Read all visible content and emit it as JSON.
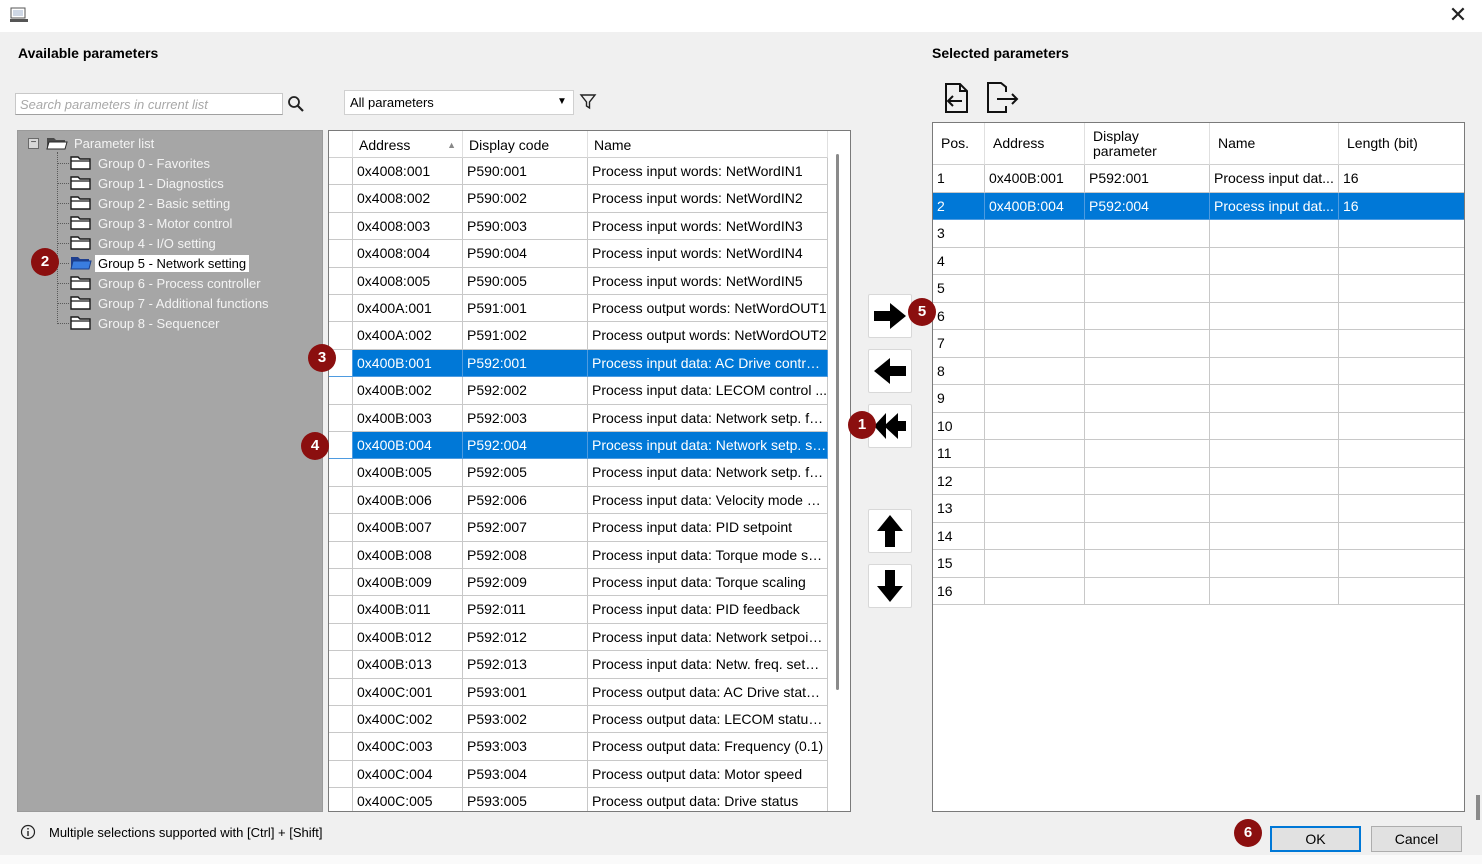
{
  "window": {
    "close_glyph": "✕"
  },
  "available": {
    "title": "Available parameters",
    "search_placeholder": "Search parameters in current list",
    "filter_value": "All parameters",
    "tree": {
      "root": "Parameter list",
      "groups": [
        "Group 0 - Favorites",
        "Group 1 - Diagnostics",
        "Group 2 - Basic setting",
        "Group 3 - Motor control",
        "Group 4 - I/O setting",
        "Group 5 - Network setting",
        "Group 6 - Process controller",
        "Group 7 - Additional functions",
        "Group 8 - Sequencer"
      ],
      "selected_index": 5
    },
    "columns": [
      "Address",
      "Display code",
      "Name"
    ],
    "rows": [
      [
        "0x4008:001",
        "P590:001",
        "Process input words: NetWordIN1"
      ],
      [
        "0x4008:002",
        "P590:002",
        "Process input words: NetWordIN2"
      ],
      [
        "0x4008:003",
        "P590:003",
        "Process input words: NetWordIN3"
      ],
      [
        "0x4008:004",
        "P590:004",
        "Process input words: NetWordIN4"
      ],
      [
        "0x4008:005",
        "P590:005",
        "Process input words: NetWordIN5"
      ],
      [
        "0x400A:001",
        "P591:001",
        "Process output words: NetWordOUT1"
      ],
      [
        "0x400A:002",
        "P591:002",
        "Process output words: NetWordOUT2"
      ],
      [
        "0x400B:001",
        "P592:001",
        "Process input data: AC Drive control ..."
      ],
      [
        "0x400B:002",
        "P592:002",
        "Process input data: LECOM control ..."
      ],
      [
        "0x400B:003",
        "P592:003",
        "Process input data: Network setp. fre..."
      ],
      [
        "0x400B:004",
        "P592:004",
        "Process input data: Network setp. sp..."
      ],
      [
        "0x400B:005",
        "P592:005",
        "Process input data: Network setp. fre..."
      ],
      [
        "0x400B:006",
        "P592:006",
        "Process input data: Velocity mode se..."
      ],
      [
        "0x400B:007",
        "P592:007",
        "Process input data: PID setpoint"
      ],
      [
        "0x400B:008",
        "P592:008",
        "Process input data: Torque mode set..."
      ],
      [
        "0x400B:009",
        "P592:009",
        "Process input data: Torque scaling"
      ],
      [
        "0x400B:011",
        "P592:011",
        "Process input data: PID feedback"
      ],
      [
        "0x400B:012",
        "P592:012",
        "Process input data: Network setpoint..."
      ],
      [
        "0x400B:013",
        "P592:013",
        "Process input data: Netw. freq. setp. ..."
      ],
      [
        "0x400C:001",
        "P593:001",
        "Process output data: AC Drive status..."
      ],
      [
        "0x400C:002",
        "P593:002",
        "Process output data: LECOM status ..."
      ],
      [
        "0x400C:003",
        "P593:003",
        "Process output data: Frequency (0.1)"
      ],
      [
        "0x400C:004",
        "P593:004",
        "Process output data: Motor speed"
      ],
      [
        "0x400C:005",
        "P593:005",
        "Process output data: Drive status"
      ]
    ],
    "selected_rows": [
      7,
      10
    ]
  },
  "selected": {
    "title": "Selected parameters",
    "columns": [
      "Pos.",
      "Address",
      "Display parameter",
      "Name",
      "Length (bit)"
    ],
    "rows": [
      [
        "1",
        "0x400B:001",
        "P592:001",
        "Process input dat...",
        "16"
      ],
      [
        "2",
        "0x400B:004",
        "P592:004",
        "Process input dat...",
        "16"
      ],
      [
        "3",
        "",
        "",
        "",
        ""
      ],
      [
        "4",
        "",
        "",
        "",
        ""
      ],
      [
        "5",
        "",
        "",
        "",
        ""
      ],
      [
        "6",
        "",
        "",
        "",
        ""
      ],
      [
        "7",
        "",
        "",
        "",
        ""
      ],
      [
        "8",
        "",
        "",
        "",
        ""
      ],
      [
        "9",
        "",
        "",
        "",
        ""
      ],
      [
        "10",
        "",
        "",
        "",
        ""
      ],
      [
        "11",
        "",
        "",
        "",
        ""
      ],
      [
        "12",
        "",
        "",
        "",
        ""
      ],
      [
        "13",
        "",
        "",
        "",
        ""
      ],
      [
        "14",
        "",
        "",
        "",
        ""
      ],
      [
        "15",
        "",
        "",
        "",
        ""
      ],
      [
        "16",
        "",
        "",
        "",
        ""
      ]
    ],
    "selected_rows": [
      1
    ]
  },
  "badges": [
    "1",
    "2",
    "3",
    "4",
    "5",
    "6"
  ],
  "footer": {
    "hint": "Multiple selections supported with [Ctrl] + [Shift]",
    "ok_label": "OK",
    "cancel_label": "Cancel"
  },
  "colors": {
    "selection": "#0078d7",
    "badge": "#8b0f0f",
    "tree_bg": "#a6a6a6"
  }
}
